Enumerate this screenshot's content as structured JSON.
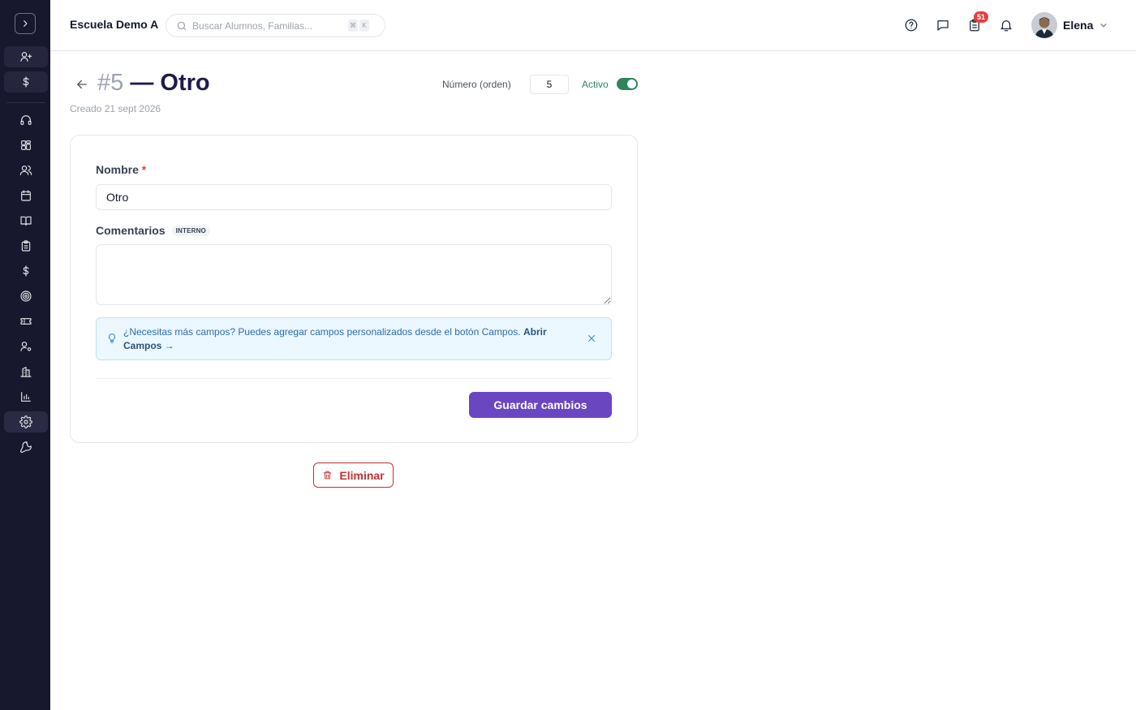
{
  "sidebar": {
    "toggle_icon": "chevron-right-icon",
    "items": [
      {
        "icon": "user-plus-icon",
        "state": "shaded"
      },
      {
        "icon": "dollar-icon",
        "state": "shaded"
      },
      {
        "icon": "headset-icon",
        "state": ""
      },
      {
        "icon": "dashboard-grid-icon",
        "state": ""
      },
      {
        "icon": "users-icon",
        "state": ""
      },
      {
        "icon": "calendar-icon",
        "state": ""
      },
      {
        "icon": "book-icon",
        "state": ""
      },
      {
        "icon": "clipboard-icon",
        "state": ""
      },
      {
        "icon": "dollar-icon",
        "state": ""
      },
      {
        "icon": "target-icon",
        "state": ""
      },
      {
        "icon": "ticket-icon",
        "state": ""
      },
      {
        "icon": "user-settings-icon",
        "state": ""
      },
      {
        "icon": "building-icon",
        "state": ""
      },
      {
        "icon": "bar-chart-icon",
        "state": ""
      },
      {
        "icon": "gear-icon",
        "state": "active"
      },
      {
        "icon": "wrench-icon",
        "state": ""
      }
    ]
  },
  "header": {
    "school_name": "Escuela Demo A",
    "search_placeholder": "Buscar Alumnos, Familias...",
    "search_kbd": [
      "⌘",
      "K"
    ],
    "tasks_badge": "51",
    "user_name": "Elena"
  },
  "page": {
    "number": "#5",
    "title": "— Otro",
    "created": "Creado 21 sept 2026",
    "order_label": "Número (orden)",
    "order_value": "5",
    "active_label": "Activo",
    "active": true
  },
  "form": {
    "name_label": "Nombre",
    "required_mark": "*",
    "name_value": "Otro",
    "comments_label": "Comentarios",
    "comments_tag": "INTERNO",
    "comments_value": "",
    "tip_text": "¿Necesitas más campos? Puedes agregar campos personalizados desde el botón Campos.",
    "tip_link": "Abrir Campos →",
    "save_label": "Guardar cambios"
  },
  "actions": {
    "delete_label": "Eliminar"
  },
  "colors": {
    "sidebar_bg": "#17172e",
    "primary": "#6b46c1",
    "active_green": "#2f855a",
    "danger": "#c53030",
    "info_bg": "#ebf8ff"
  }
}
